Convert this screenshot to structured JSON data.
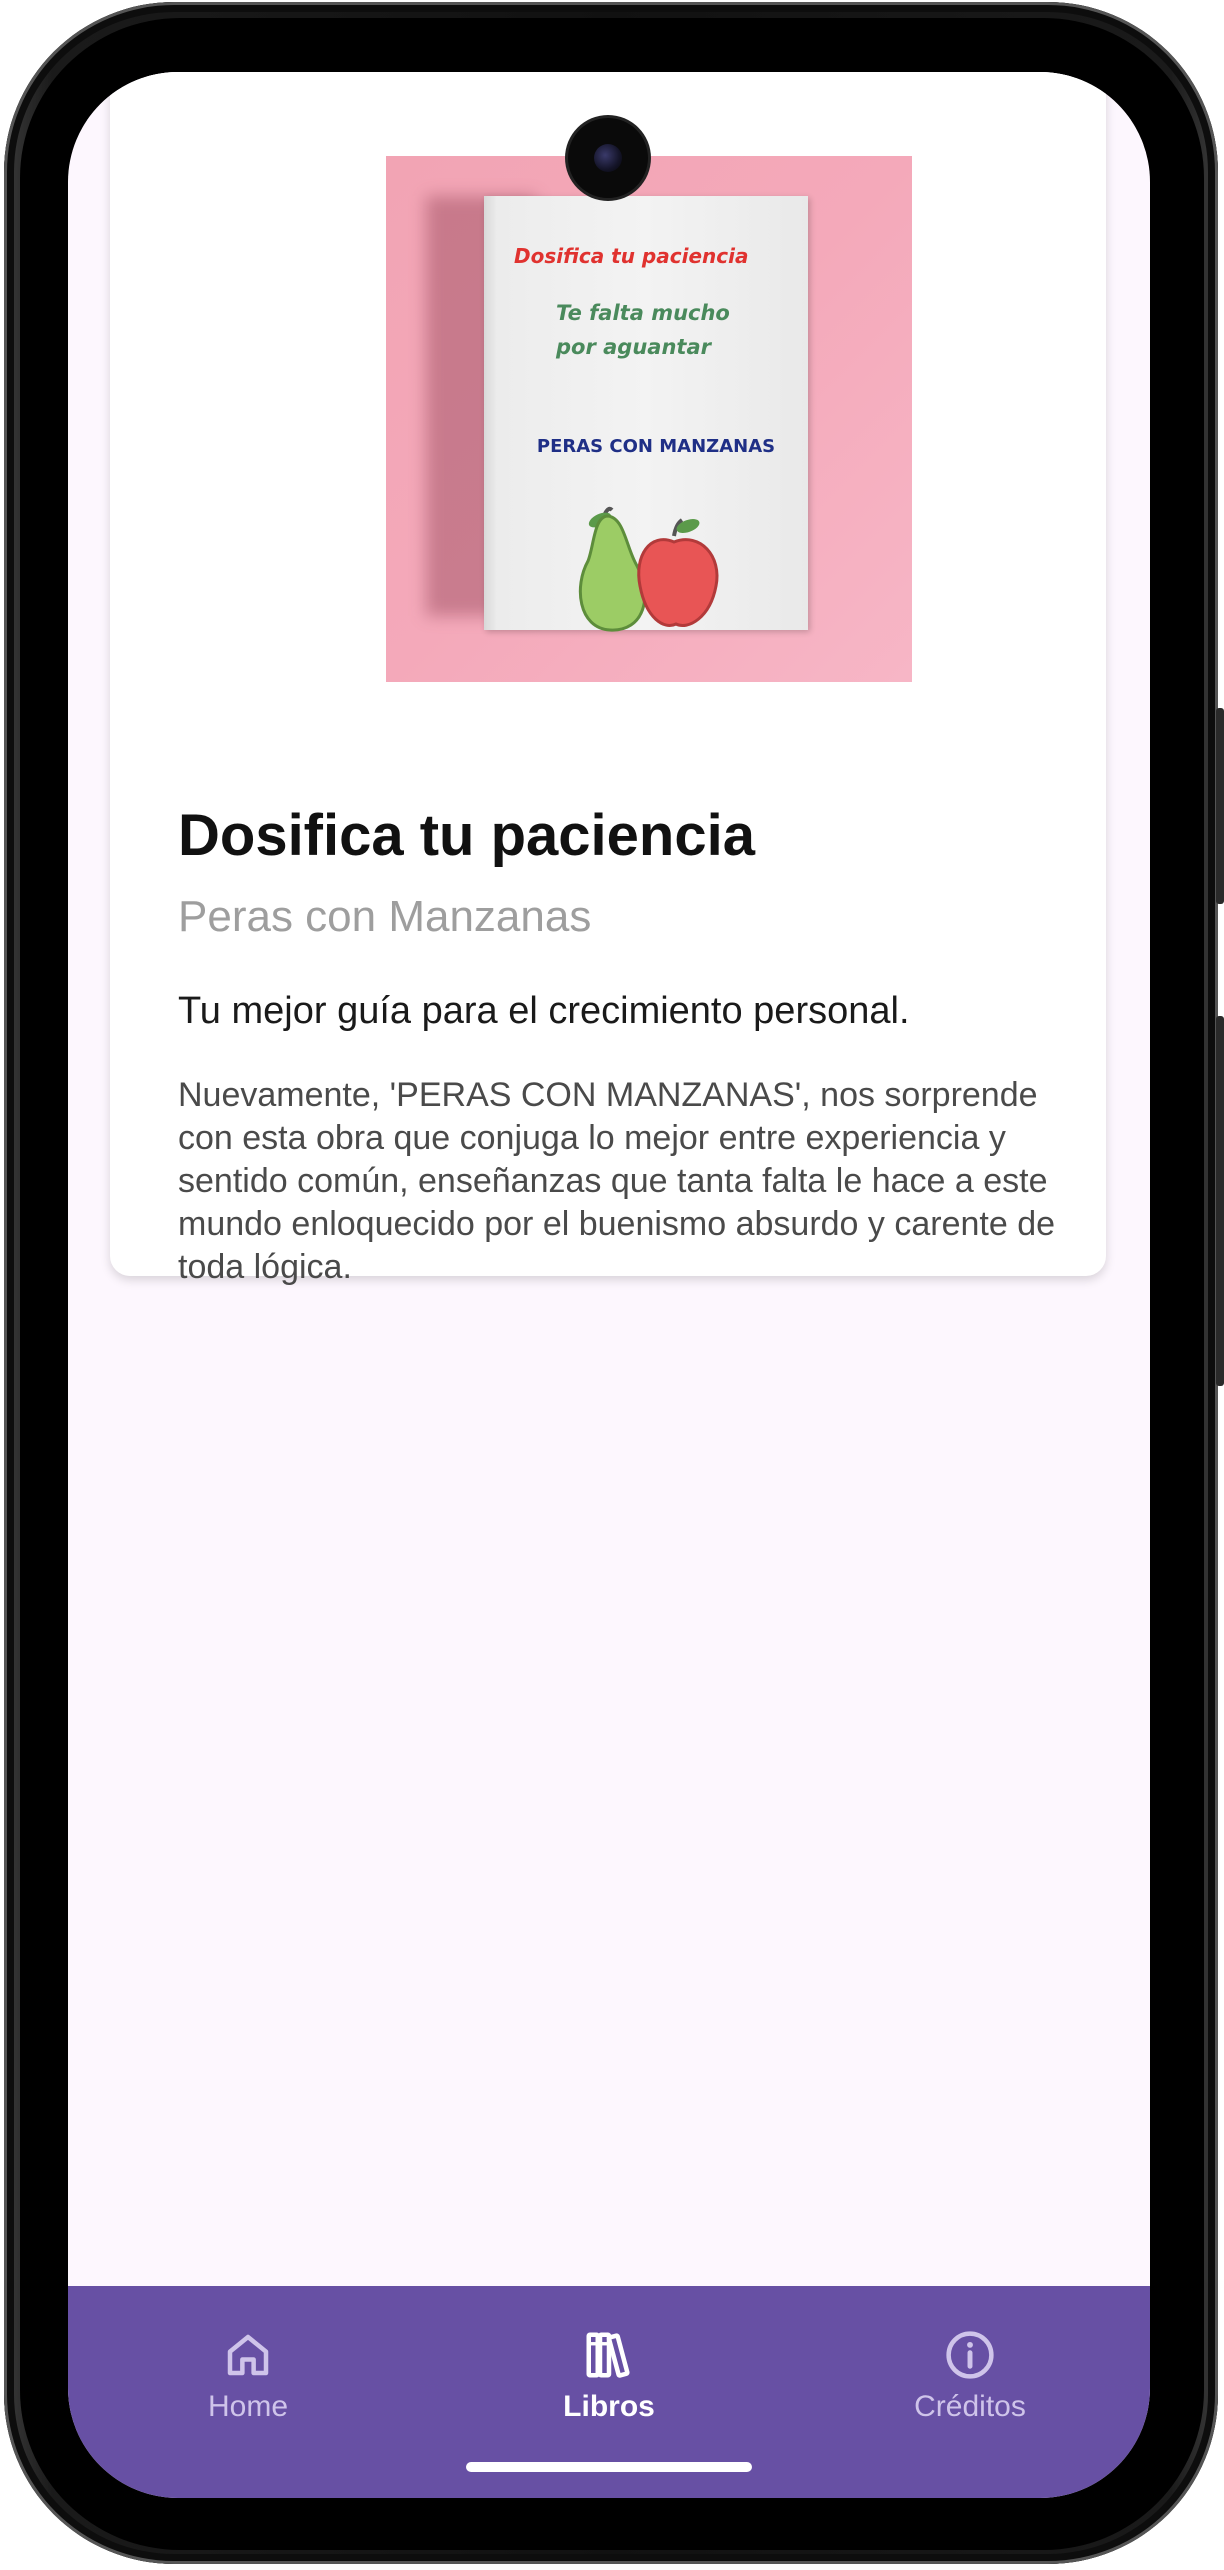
{
  "book": {
    "title": "Dosifica tu paciencia",
    "author": "Peras con Manzanas",
    "tagline": "Tu mejor guía para el crecimiento personal.",
    "description": "Nuevamente, 'PERAS CON MANZANAS', nos sorprende con esta obra que conjuga lo mejor entre experiencia y sentido común, enseñanzas que tanta falta le hace a este mundo enloquecido por el buenismo absurdo y carente de toda lógica.",
    "cover": {
      "line1": "Dosifica tu paciencia",
      "line2": "Te falta mucho por aguantar",
      "line3": "PERAS CON MANZANAS"
    }
  },
  "nav": {
    "items": [
      {
        "label": "Home",
        "icon": "home-icon",
        "active": false
      },
      {
        "label": "Libros",
        "icon": "books-icon",
        "active": true
      },
      {
        "label": "Créditos",
        "icon": "info-icon",
        "active": false
      }
    ]
  },
  "colors": {
    "nav_background": "#6750a4",
    "screen_background": "#fdf7fe",
    "nav_inactive": "#cfc4ea",
    "nav_active": "#ffffff"
  }
}
